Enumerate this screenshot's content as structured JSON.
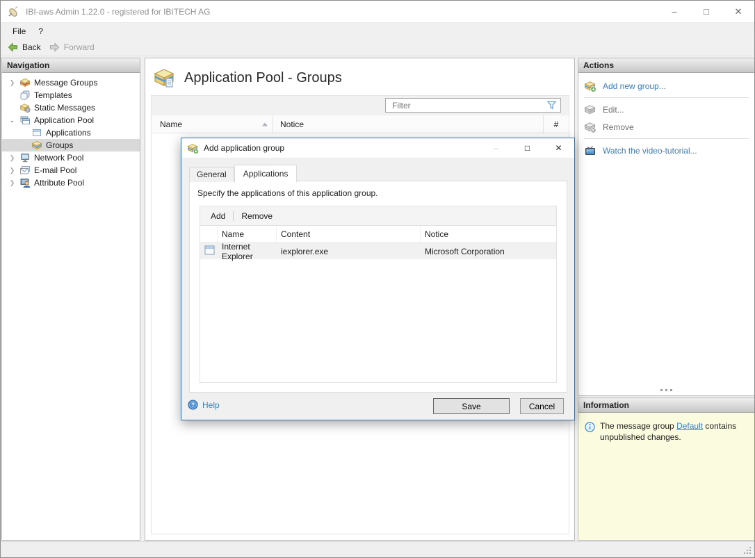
{
  "window": {
    "title": "IBI-aws Admin 1.22.0 - registered for IBITECH AG",
    "app_icon": "ibi-aws-app-icon",
    "controls": [
      {
        "name": "minimize-icon",
        "glyph": "–"
      },
      {
        "name": "maximize-icon",
        "glyph": "□"
      },
      {
        "name": "close-icon",
        "glyph": "✕"
      }
    ]
  },
  "menubar": {
    "items": [
      {
        "label": "File"
      },
      {
        "label": "?"
      }
    ]
  },
  "toolbar": {
    "back_label": "Back",
    "forward_label": "Forward"
  },
  "navigation": {
    "header": "Navigation",
    "items": [
      {
        "label": "Message Groups",
        "icon": "message-groups-icon",
        "state": "collapsed"
      },
      {
        "label": "Templates",
        "icon": "templates-icon",
        "state": "leaf"
      },
      {
        "label": "Static Messages",
        "icon": "static-messages-icon",
        "state": "leaf"
      },
      {
        "label": "Application Pool",
        "icon": "application-pool-icon",
        "state": "expanded"
      },
      {
        "label": "Applications",
        "icon": "applications-icon",
        "state": "child-leaf"
      },
      {
        "label": "Groups",
        "icon": "groups-icon",
        "state": "child-leaf",
        "selected": true
      },
      {
        "label": "Network Pool",
        "icon": "network-pool-icon",
        "state": "collapsed"
      },
      {
        "label": "E-mail Pool",
        "icon": "email-pool-icon",
        "state": "collapsed"
      },
      {
        "label": "Attribute Pool",
        "icon": "attribute-pool-icon",
        "state": "collapsed"
      }
    ]
  },
  "main": {
    "title": "Application Pool - Groups",
    "title_icon": "groups-box-icon",
    "filter_placeholder": "Filter",
    "columns": {
      "name": "Name",
      "notice": "Notice",
      "count": "#"
    }
  },
  "actions": {
    "header": "Actions",
    "add_new_group": "Add new group...",
    "edit": "Edit...",
    "remove": "Remove",
    "watch_tutorial": "Watch the video-tutorial..."
  },
  "information": {
    "header": "Information",
    "text_before": "The message group ",
    "link_text": "Default",
    "text_after": " contains unpublished changes."
  },
  "dialog": {
    "title": "Add application group",
    "tabs": [
      {
        "label": "General"
      },
      {
        "label": "Applications"
      }
    ],
    "active_tab": "Applications",
    "description": "Specify the applications of this application group.",
    "toolbar": {
      "add": "Add",
      "remove": "Remove"
    },
    "columns": {
      "name": "Name",
      "content": "Content",
      "notice": "Notice"
    },
    "rows": [
      {
        "icon": "application-window-icon",
        "name": "Internet Explorer",
        "content": "iexplorer.exe",
        "notice": "Microsoft Corporation"
      }
    ],
    "help": "Help",
    "save": "Save",
    "cancel": "Cancel"
  },
  "colors": {
    "link": "#3e7dbd",
    "accent_blue": "#4a90d9",
    "dialog_border": "#3a6ea5",
    "info_bg": "#fbfbdf",
    "selected_bg": "#d9d9d9"
  }
}
